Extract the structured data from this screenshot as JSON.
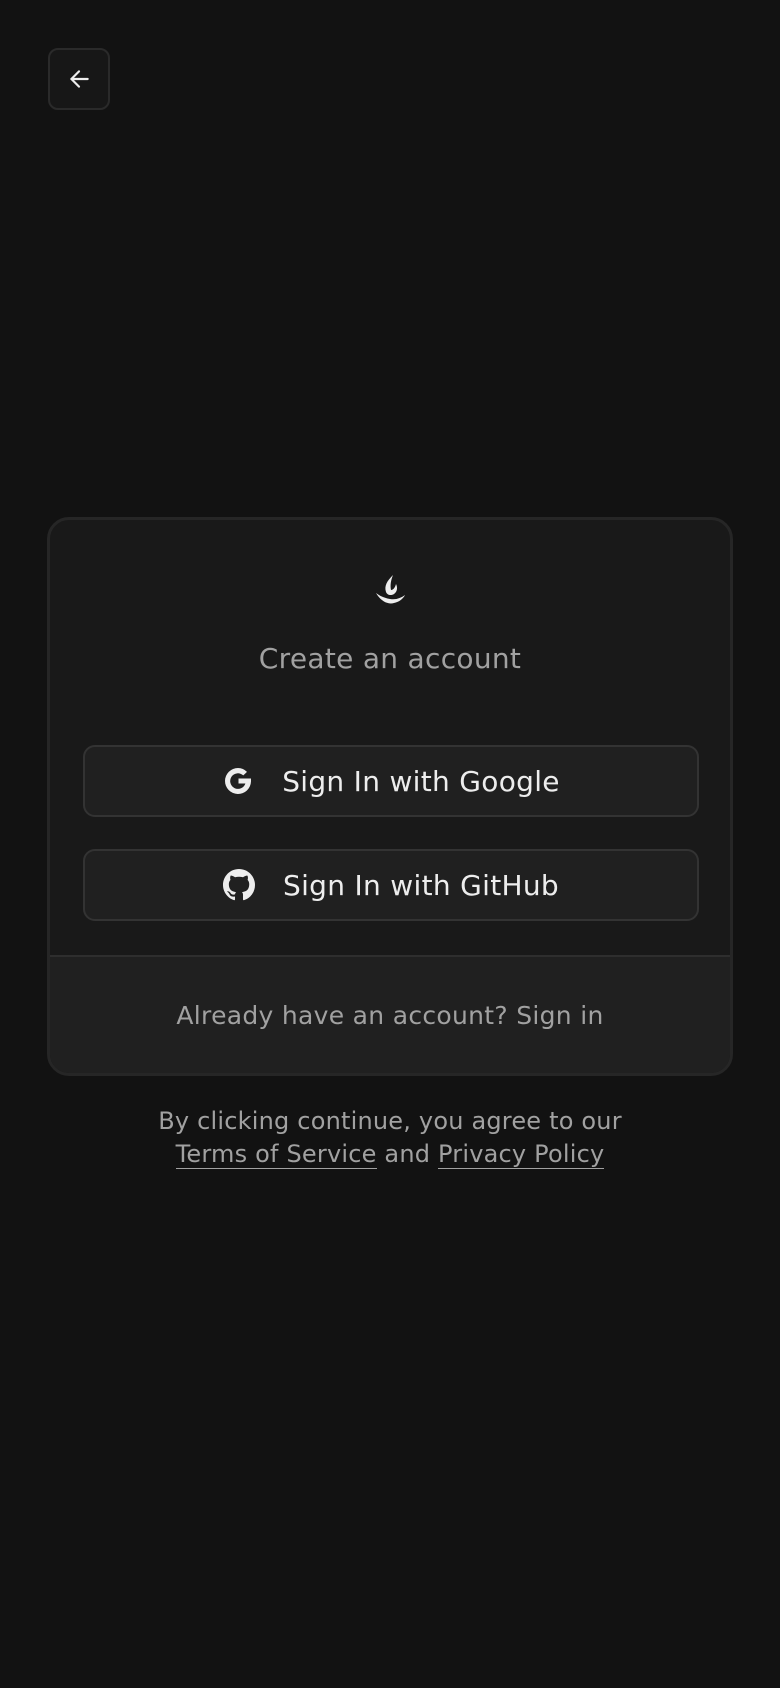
{
  "nav": {
    "back_icon": "arrow-left-icon"
  },
  "card": {
    "logo_icon": "flame-logo-icon",
    "title": "Create an account",
    "google_button": {
      "icon": "google-icon",
      "label": "Sign In with Google"
    },
    "github_button": {
      "icon": "github-icon",
      "label": "Sign In with GitHub"
    },
    "footer": {
      "prompt": "Already have an account?",
      "signin_label": "Sign in"
    }
  },
  "legal": {
    "line1": "By clicking continue, you agree to our",
    "terms_label": "Terms of Service",
    "and_label": "and",
    "privacy_label": "Privacy Policy"
  },
  "colors": {
    "background": "#121212",
    "card_background": "#191919",
    "card_footer_background": "#202020",
    "border": "#262626",
    "text_primary": "#ededed",
    "text_muted": "#a1a1a1"
  }
}
